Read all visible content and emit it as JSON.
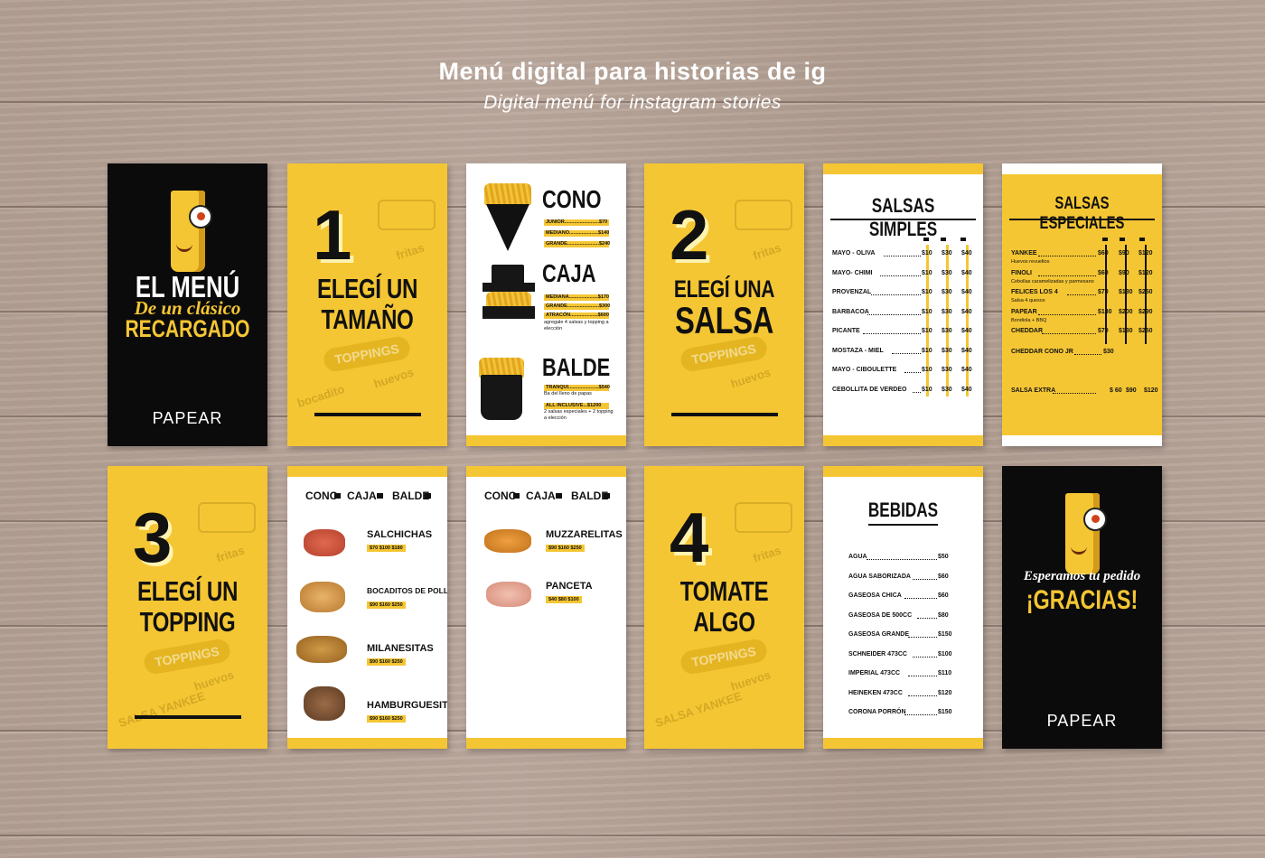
{
  "header": {
    "title": "Menú digital para historias de ig",
    "subtitle": "Digital menú for instagram stories"
  },
  "cover": {
    "line1": "EL MENÚ",
    "line2": "De un clásico",
    "line3": "RECARGADO",
    "logo": "PAPEAR"
  },
  "step1": {
    "number": "1",
    "line1": "ELEGÍ UN",
    "line2": "TAMAÑO",
    "badge": "TOPPINGS"
  },
  "sizes": {
    "items": [
      {
        "name": "CONO",
        "prices": [
          "JUNIOR.........................$70",
          "MEDIANO.....................$140",
          "GRANDE.......................$240"
        ],
        "note": ""
      },
      {
        "name": "CAJA",
        "prices": [
          "MEDIANA.....................$170",
          "GRANDE.......................$300",
          "ATRACÓN....................$600"
        ],
        "note": "agregale 4 salsas y topping a elección"
      },
      {
        "name": "BALDE",
        "prices": [
          "TRANQUI......................$540"
        ],
        "note": "Ba del lleno de papas",
        "prices2": [
          "ALL INCLUSIVE...$1200"
        ],
        "note2": "2 salsas especiales + 2 topping a elección"
      }
    ]
  },
  "step2": {
    "number": "2",
    "line1": "ELEGÍ UNA",
    "line2": "SALSA",
    "badge": "TOPPINGS"
  },
  "salsas_simples": {
    "title": "SALSAS SIMPLES",
    "rows": [
      {
        "name": "MAYO - OLIVA",
        "p1": "$10",
        "p2": "$30",
        "p3": "$40"
      },
      {
        "name": "MAYO- CHIMI",
        "p1": "$10",
        "p2": "$30",
        "p3": "$40"
      },
      {
        "name": "PROVENZAL",
        "p1": "$10",
        "p2": "$30",
        "p3": "$40"
      },
      {
        "name": "BARBACOA",
        "p1": "$10",
        "p2": "$30",
        "p3": "$40"
      },
      {
        "name": "PICANTE",
        "p1": "$10",
        "p2": "$30",
        "p3": "$40"
      },
      {
        "name": "MOSTAZA - MIEL",
        "p1": "$10",
        "p2": "$30",
        "p3": "$40"
      },
      {
        "name": "MAYO - CIBOULETTE",
        "p1": "$10",
        "p2": "$30",
        "p3": "$40"
      },
      {
        "name": "CEBOLLITA DE VERDEO",
        "p1": "$10",
        "p2": "$30",
        "p3": "$40"
      }
    ]
  },
  "salsas_especiales": {
    "title": "SALSAS ESPECIALES",
    "rows": [
      {
        "name": "YANKEE",
        "sub": "Huevos revueltos",
        "p1": "$60",
        "p2": "$90",
        "p3": "$120"
      },
      {
        "name": "FINOLI",
        "sub": "Cebollas caramelizadas y parmesano",
        "p1": "$60",
        "p2": "$90",
        "p3": "$120"
      },
      {
        "name": "FELICES LOS 4",
        "sub": "Salsa 4 quesos",
        "p1": "$70",
        "p2": "$130",
        "p3": "$250"
      },
      {
        "name": "PAPEAR",
        "sub": "Bondiola + BBQ",
        "p1": "$130",
        "p2": "$200",
        "p3": "$290"
      },
      {
        "name": "CHEDDAR",
        "sub": "",
        "p1": "$70",
        "p2": "$130",
        "p3": "$250"
      }
    ],
    "extra1_name": "CHEDDAR CONO JR",
    "extra1_price": "$30",
    "extra2_name": "SALSA EXTRA",
    "extra2_p1": "$ 60",
    "extra2_p2": "$90",
    "extra2_p3": "$120"
  },
  "step3": {
    "number": "3",
    "line1": "ELEGÍ UN",
    "line2": "TOPPING",
    "badge": "TOPPINGS"
  },
  "tabs": {
    "cono": "CONO",
    "caja": "CAJA",
    "balde": "BALDE"
  },
  "toppings_a": [
    {
      "name": "SALCHICHAS",
      "prices": "$70  $100  $180"
    },
    {
      "name": "BOCADITOS DE POLLO",
      "prices": "$90  $160  $250"
    },
    {
      "name": "MILANESITAS",
      "prices": "$90  $160  $250"
    },
    {
      "name": "HAMBURGUESITAS",
      "prices": "$90  $160  $250"
    }
  ],
  "toppings_b": [
    {
      "name": "MUZZARELITAS",
      "prices": "$90  $160  $250"
    },
    {
      "name": "PANCETA",
      "prices": "$40  $80  $100"
    }
  ],
  "step4": {
    "number": "4",
    "line1": "TOMATE",
    "line2": "ALGO",
    "badge": "TOPPINGS"
  },
  "bebidas": {
    "title": "BEBIDAS",
    "rows": [
      {
        "name": "AGUA",
        "price": "$50"
      },
      {
        "name": "AGUA SABORIZADA",
        "price": "$60"
      },
      {
        "name": "GASEOSA CHICA",
        "price": "$60"
      },
      {
        "name": "GASEOSA DE 500CC",
        "price": "$80"
      },
      {
        "name": "GASEOSA GRANDE",
        "price": "$150"
      },
      {
        "name": "SCHNEIDER 473CC",
        "price": "$100"
      },
      {
        "name": "IMPERIAL 473CC",
        "price": "$110"
      },
      {
        "name": "HEINEKEN 473CC",
        "price": "$120"
      },
      {
        "name": "CORONA PORRÓN",
        "price": "$150"
      }
    ]
  },
  "thanks": {
    "line1": "Esperamos tu pedido",
    "line2": "¡GRACIAS!",
    "logo": "PAPEAR"
  },
  "colors": {
    "yellow": "#f5c633",
    "black": "#0c0b0b",
    "wood": "#b8a59a"
  }
}
